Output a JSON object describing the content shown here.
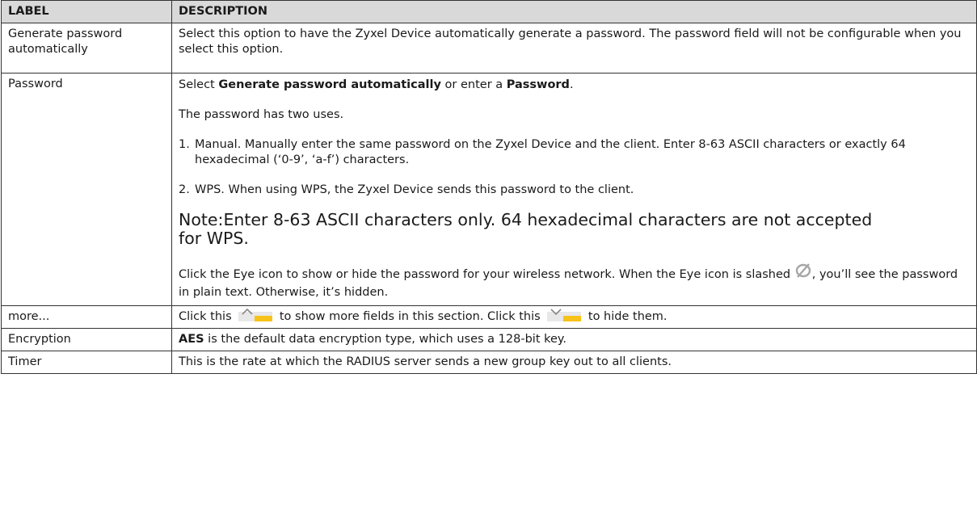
{
  "header": {
    "col1": "LABEL",
    "col2": "DESCRIPTION"
  },
  "rows": {
    "generate": {
      "label": "Generate password automatically",
      "desc": "Select this option to have the Zyxel Device automatically generate a password. The password field will not be configurable when you select this option."
    },
    "password": {
      "label": "Password",
      "line1_a": "Select ",
      "line1_b": "Generate password automatically",
      "line1_c": " or enter a ",
      "line1_d": "Password",
      "line1_e": ".",
      "line2": "The password has two uses.",
      "item1_num": "1.",
      "item1": "Manual. Manually enter the same password on the Zyxel Device and the client. Enter 8-63 ASCII characters or exactly 64 hexadecimal (‘0-9’, ‘a-f’) characters.",
      "item2_num": "2.",
      "item2": "WPS. When using WPS, the Zyxel Device sends this password to the client.",
      "note_label": "Note: ",
      "note_line1": "Enter 8-63 ASCII characters only. 64 hexadecimal characters are not accepted",
      "note_line2": "for WPS.",
      "eye_a": "Click the Eye icon to show or hide the password for your wireless network. When the Eye icon is slashed ",
      "eye_b": ", you’ll see the password in plain text. Otherwise, it’s hidden."
    },
    "more": {
      "label": "more...",
      "a": "Click this ",
      "b": " to show more fields in this section. Click this ",
      "c": " to hide them."
    },
    "encryption": {
      "label": "Encryption",
      "bold": "AES",
      "rest": " is the default data encryption type, which uses a 128-bit key."
    },
    "timer": {
      "label": "Timer",
      "desc": "This is the rate at which the RADIUS server sends a new group key out to all clients."
    }
  },
  "icons": {
    "eye_slash": "eye-slash-icon",
    "expand": "chevron-up-icon",
    "collapse": "chevron-down-icon",
    "accent_yellow": "#f7c21a"
  }
}
